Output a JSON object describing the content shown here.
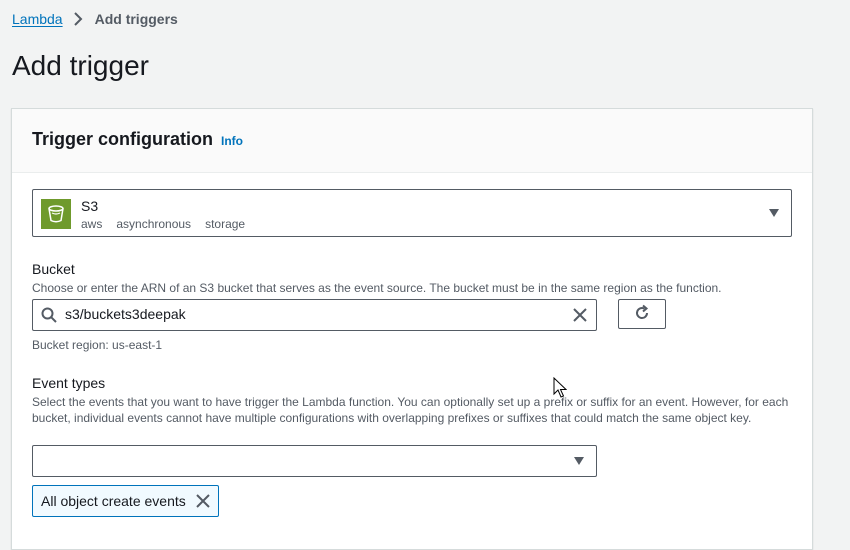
{
  "breadcrumb": {
    "root": "Lambda",
    "current": "Add triggers"
  },
  "page_title": "Add trigger",
  "panel": {
    "title": "Trigger configuration",
    "info_link": "Info"
  },
  "trigger_source": {
    "name": "S3",
    "tags": [
      "aws",
      "asynchronous",
      "storage"
    ],
    "logo_color": "#6f9a2c"
  },
  "bucket": {
    "label": "Bucket",
    "description": "Choose or enter the ARN of an S3 bucket that serves as the event source. The bucket must be in the same region as the function.",
    "value": "s3/buckets3deepak",
    "region_text": "Bucket region: us-east-1"
  },
  "event_types": {
    "label": "Event types",
    "description": "Select the events that you want to have trigger the Lambda function. You can optionally set up a prefix or suffix for an event. However, for each bucket, individual events cannot have multiple configurations with overlapping prefixes or suffixes that could match the same object key.",
    "selected_value": "",
    "tokens": [
      "All object create events"
    ]
  },
  "colors": {
    "link": "#0073bb",
    "text": "#16191f",
    "secondary_text": "#545b64",
    "background": "#f2f3f3"
  }
}
